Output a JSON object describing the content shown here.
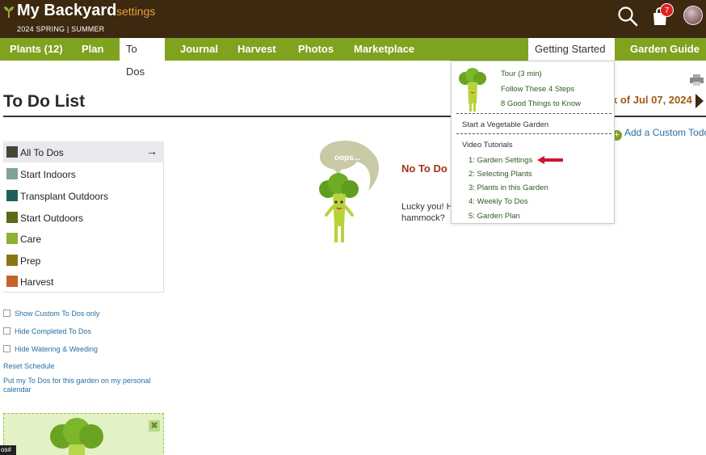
{
  "header": {
    "app_title": "My Backyard",
    "settings_link": "settings",
    "season": "2024 SPRING | SUMMER",
    "cart_count": "7",
    "icons": [
      "sprout-icon",
      "search-icon",
      "cart-icon",
      "avatar"
    ]
  },
  "nav": {
    "items": [
      {
        "label": "Plants (12)"
      },
      {
        "label": "Plan"
      },
      {
        "label": "To Dos"
      },
      {
        "label": "Journal"
      },
      {
        "label": "Harvest"
      },
      {
        "label": "Photos"
      },
      {
        "label": "Marketplace"
      },
      {
        "label": "Getting Started"
      },
      {
        "label": "Garden Guide"
      }
    ],
    "active": "To Dos",
    "open_menu": "Getting Started"
  },
  "page": {
    "title": "To Do List",
    "week_label": "k of  Jul 07, 2024",
    "add_todo": "Add a Custom Todo"
  },
  "filters": [
    {
      "label": "All To Dos",
      "color": "#474535"
    },
    {
      "label": "Start Indoors",
      "color": "#7fa29b"
    },
    {
      "label": "Transplant Outdoors",
      "color": "#1f5f5a"
    },
    {
      "label": "Start Outdoors",
      "color": "#5a6b14"
    },
    {
      "label": "Care",
      "color": "#8fb034"
    },
    {
      "label": "Prep",
      "color": "#8c7515"
    },
    {
      "label": "Harvest",
      "color": "#c4622a"
    }
  ],
  "options": {
    "show_custom": "Show Custom To Dos only",
    "hide_completed": "Hide Completed To Dos",
    "hide_watering": "Hide Watering & Weeding",
    "reset": "Reset Schedule",
    "calendar": "Put my To Dos for this garden on my personal calendar"
  },
  "empty_state": {
    "bubble": "oops...",
    "title": "No To Do",
    "body_line1": "Lucky you! H",
    "body_line2": "hammock?"
  },
  "dropdown": {
    "tour": "Tour (3 min)",
    "steps": "Follow These 4 Steps",
    "good_things": "8 Good Things to Know",
    "start_garden": "Start a Vegetable Garden",
    "video_heading": "Video Tutorials",
    "videos": [
      "1: Garden Settings",
      "2: Selecting Plants",
      "3: Plants in this Garden",
      "4: Weekly To Dos",
      "5: Garden Plan"
    ]
  },
  "tooltip": "os#",
  "colors": {
    "header_bg": "#3d2810",
    "nav_bg": "#7fa21f",
    "accent_orange": "#e8a33a",
    "link_blue": "#2a6ea0",
    "empty_title_red": "#a0331c"
  }
}
